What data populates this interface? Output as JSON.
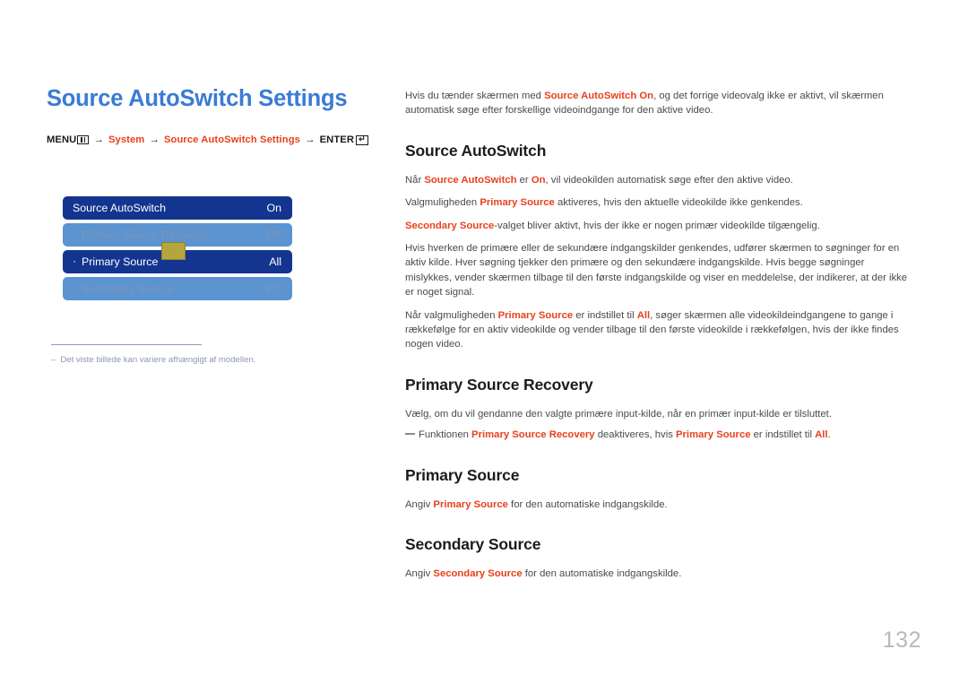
{
  "page": {
    "title": "Source AutoSwitch Settings",
    "number": "132"
  },
  "menu_path": {
    "menu_label": "MENU",
    "menu_icon": "menu-grid-icon",
    "arrow": "→",
    "system_label": "System",
    "settings_label": "Source AutoSwitch Settings",
    "enter_label": "ENTER",
    "enter_icon": "enter-return-icon",
    "enter_glyph": "↵"
  },
  "osd": {
    "cursor_color": "#b5a53f",
    "active_color": "#14358f",
    "disabled_color": "#5b94d0",
    "rows": [
      {
        "bullet": "",
        "label": "Source AutoSwitch",
        "value": "On",
        "state": "active"
      },
      {
        "bullet": "·",
        "label": "Primary Source Recovery",
        "value": "Off",
        "state": "disabled"
      },
      {
        "bullet": "·",
        "label": "Primary Source",
        "value": "All",
        "state": "active"
      },
      {
        "bullet": "·",
        "label": "Secondary Source",
        "value": "PC",
        "state": "disabled"
      }
    ]
  },
  "footnote": {
    "dash": "–",
    "text": "Det viste billede kan variere afhængigt af modellen."
  },
  "intro": {
    "p1_a": "Hvis du tænder skærmen med ",
    "p1_kw": "Source AutoSwitch On",
    "p1_b": ", og det forrige videovalg ikke er aktivt, vil skærmen automatisk søge efter forskellige videoindgange for den aktive video."
  },
  "sections": {
    "source_autoswitch": {
      "heading": "Source AutoSwitch",
      "p1_a": "Når ",
      "p1_kw1": "Source AutoSwitch",
      "p1_b": " er ",
      "p1_kw2": "On",
      "p1_c": ", vil videokilden automatisk søge efter den aktive video.",
      "p2_a": "Valgmuligheden ",
      "p2_kw": "Primary Source",
      "p2_b": " aktiveres, hvis den aktuelle videokilde ikke genkendes.",
      "p3_kw": "Secondary Source",
      "p3_b": "-valget bliver aktivt, hvis der ikke er nogen primær videokilde tilgængelig.",
      "p4": "Hvis hverken de primære eller de sekundære indgangskilder genkendes, udfører skærmen to søgninger for en aktiv kilde. Hver søgning tjekker den primære og den sekundære indgangskilde. Hvis begge søgninger mislykkes, vender skærmen tilbage til den første indgangskilde og viser en meddelelse, der indikerer, at der ikke er noget signal.",
      "p5_a": "Når valgmuligheden ",
      "p5_kw1": "Primary Source",
      "p5_b": " er indstillet til ",
      "p5_kw2": "All",
      "p5_c": ", søger skærmen alle videokildeindgangene to gange i rækkefølge for en aktiv videokilde og vender tilbage til den første videokilde i rækkefølgen, hvis der ikke findes nogen video."
    },
    "primary_source_recovery": {
      "heading": "Primary Source Recovery",
      "p1": "Vælg, om du vil gendanne den valgte primære input-kilde, når en primær input-kilde er tilsluttet.",
      "note_a": "Funktionen ",
      "note_kw1": "Primary Source Recovery",
      "note_b": " deaktiveres, hvis ",
      "note_kw2": "Primary Source",
      "note_c": " er indstillet til ",
      "note_kw3": "All",
      "note_d": "."
    },
    "primary_source": {
      "heading": "Primary Source",
      "p1_a": "Angiv ",
      "p1_kw": "Primary Source",
      "p1_b": " for den automatiske indgangskilde."
    },
    "secondary_source": {
      "heading": "Secondary Source",
      "p1_a": "Angiv ",
      "p1_kw": "Secondary Source",
      "p1_b": " for den automatiske indgangskilde."
    }
  }
}
